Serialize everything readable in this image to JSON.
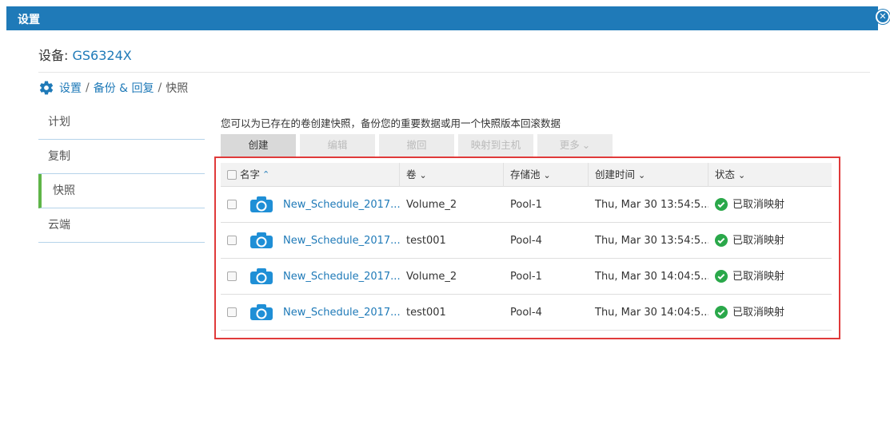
{
  "window": {
    "title": "设置"
  },
  "device": {
    "label": "设备: ",
    "name": "GS6324X"
  },
  "breadcrumb": {
    "items": [
      "设置",
      "备份 & 回复",
      "快照"
    ],
    "separator": "/"
  },
  "sidebar": {
    "items": [
      {
        "label": "计划",
        "active": false
      },
      {
        "label": "复制",
        "active": false
      },
      {
        "label": "快照",
        "active": true
      },
      {
        "label": "云端",
        "active": false
      }
    ]
  },
  "description": "您可以为已存在的卷创建快照，备份您的重要数据或用一个快照版本回滚数据",
  "toolbar": {
    "create": "创建",
    "edit": "编辑",
    "revert": "撤回",
    "map_to_host": "映射到主机",
    "more": "更多"
  },
  "table": {
    "columns": [
      "名字",
      "卷",
      "存储池",
      "创建时间",
      "状态"
    ],
    "rows": [
      {
        "name": "New_Schedule_2017...",
        "volume": "Volume_2",
        "pool": "Pool-1",
        "created": "Thu, Mar 30 13:54:5...",
        "status": "已取消映射"
      },
      {
        "name": "New_Schedule_2017...",
        "volume": "test001",
        "pool": "Pool-4",
        "created": "Thu, Mar 30 13:54:5...",
        "status": "已取消映射"
      },
      {
        "name": "New_Schedule_2017...",
        "volume": "Volume_2",
        "pool": "Pool-1",
        "created": "Thu, Mar 30 14:04:5...",
        "status": "已取消映射"
      },
      {
        "name": "New_Schedule_2017...",
        "volume": "test001",
        "pool": "Pool-4",
        "created": "Thu, Mar 30 14:04:5...",
        "status": "已取消映射"
      }
    ]
  },
  "colors": {
    "accent": "#1f7ab8",
    "active_indicator": "#5fb548",
    "highlight_box": "#e03a3a",
    "status_ok": "#2aa84a"
  },
  "icons": {
    "close": "close-circle-icon",
    "settings": "gear-icon",
    "snapshot": "camera-icon",
    "status": "check-circle-icon"
  }
}
